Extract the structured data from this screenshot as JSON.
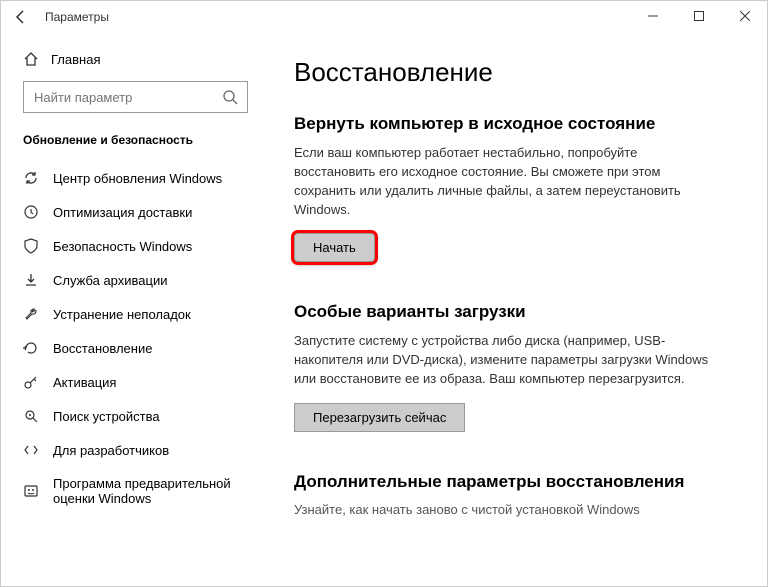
{
  "window": {
    "title": "Параметры"
  },
  "sidebar": {
    "home": "Главная",
    "search_placeholder": "Найти параметр",
    "section": "Обновление и безопасность",
    "items": [
      {
        "label": "Центр обновления Windows"
      },
      {
        "label": "Оптимизация доставки"
      },
      {
        "label": "Безопасность Windows"
      },
      {
        "label": "Служба архивации"
      },
      {
        "label": "Устранение неполадок"
      },
      {
        "label": "Восстановление"
      },
      {
        "label": "Активация"
      },
      {
        "label": "Поиск устройства"
      },
      {
        "label": "Для разработчиков"
      },
      {
        "label": "Программа предварительной оценки Windows"
      }
    ]
  },
  "content": {
    "heading": "Восстановление",
    "reset": {
      "title": "Вернуть компьютер в исходное состояние",
      "desc": "Если ваш компьютер работает нестабильно, попробуйте восстановить его исходное состояние. Вы сможете при этом сохранить или удалить личные файлы, а затем переустановить Windows.",
      "button": "Начать"
    },
    "advanced": {
      "title": "Особые варианты загрузки",
      "desc": "Запустите систему с устройства либо диска (например, USB-накопителя или DVD-диска), измените параметры загрузки Windows или восстановите ее из образа. Ваш компьютер перезагрузится.",
      "button": "Перезагрузить сейчас"
    },
    "more": {
      "title": "Дополнительные параметры восстановления",
      "link": "Узнайте, как начать заново с чистой установкой Windows"
    }
  }
}
